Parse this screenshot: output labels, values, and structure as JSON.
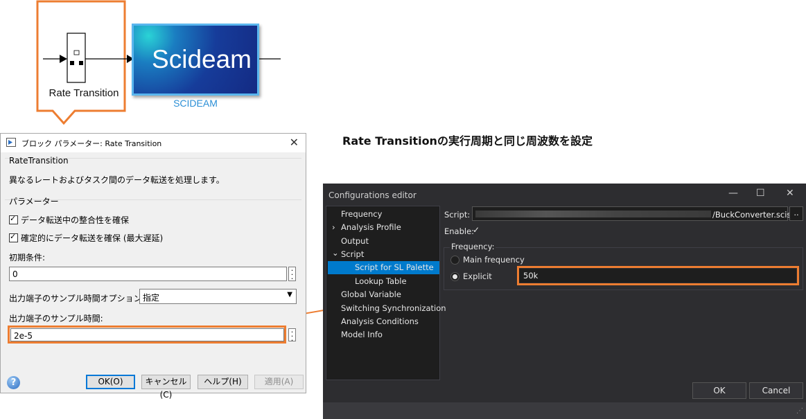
{
  "diagram": {
    "rt_block_label": "Rate Transition",
    "scideam_block_text": "Scideam",
    "scideam_caption": "SCIDEAM"
  },
  "heading": "Rate Transitionの実行周期と同じ周波数を設定",
  "block_dialog": {
    "title": "ブロック パラメーター: Rate Transition",
    "block_type": "RateTransition",
    "description": "異なるレートおよびタスク間のデータ転送を処理します。",
    "params_header": "パラメーター",
    "checkbox1": "データ転送中の整合性を確保",
    "checkbox1_checked": true,
    "checkbox2": "確定的にデータ転送を確保 (最大遅延)",
    "checkbox2_checked": true,
    "initial_label": "初期条件:",
    "initial_value": "0",
    "sample_time_option_label": "出力端子のサンプル時間オプション:",
    "sample_time_option_value": "指定",
    "sample_time_label": "出力端子のサンプル時間:",
    "sample_time_value": "2e-5",
    "buttons": {
      "ok": "OK(O)",
      "cancel": "キャンセル(C)",
      "help": "ヘルプ(H)",
      "apply": "適用(A)"
    },
    "help_icon": "?"
  },
  "config_editor": {
    "title": "Configurations editor",
    "window_controls": {
      "minimize": "—",
      "maximize": "☐",
      "close": "✕"
    },
    "tree": [
      {
        "label": "Frequency"
      },
      {
        "label": "Analysis Profile",
        "expander": "›"
      },
      {
        "label": "Output"
      },
      {
        "label": "Script",
        "expander": "⌄"
      },
      {
        "label": "Script for SL Palette",
        "selected": true
      },
      {
        "label": "Lookup Table"
      },
      {
        "label": "Global Variable"
      },
      {
        "label": "Switching Synchronization"
      },
      {
        "label": "Analysis Conditions"
      },
      {
        "label": "Model Info"
      }
    ],
    "script_label": "Script:",
    "script_value": "/BuckConverter.scislc",
    "browse_button": "..",
    "enable_label": "Enable:",
    "enable_checked": true,
    "frequency_group": "Frequency:",
    "main_frequency": "Main frequency",
    "explicit": "Explicit",
    "explicit_selected": true,
    "frequency_value": "50k",
    "ok": "OK",
    "cancel": "Cancel"
  },
  "colors": {
    "highlight": "#ed7d31",
    "accent_blue": "#007acc",
    "dark_bg": "#2d2d30"
  }
}
